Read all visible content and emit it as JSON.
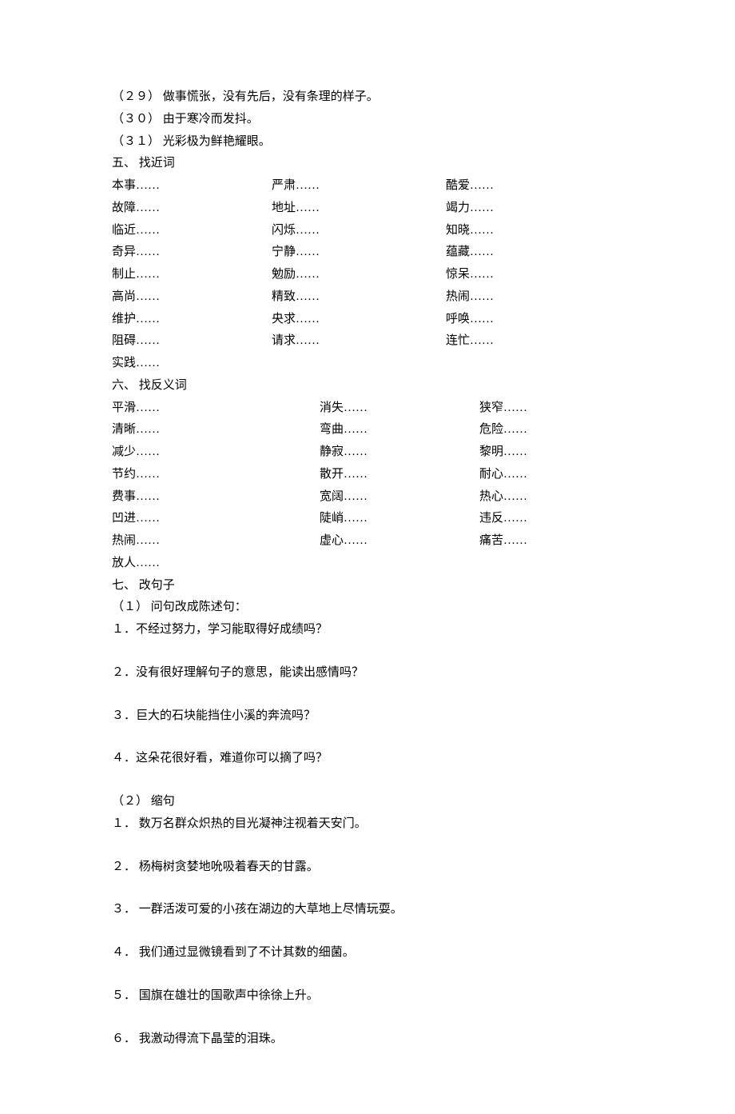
{
  "defs": [
    "（２９） 做事慌张，没有先后，没有条理的样子。",
    "（３０） 由于寒冷而发抖。",
    "（３１） 光彩极为鲜艳耀眼。"
  ],
  "sec5_title": "五、 找近词",
  "syn_rows": [
    [
      "本事……",
      "严肃……",
      "酷爱……"
    ],
    [
      "故障……",
      "地址……",
      "竭力……"
    ],
    [
      "临近……",
      "闪烁……",
      "知晓……"
    ],
    [
      "奇异……",
      "宁静……",
      "蕴藏……"
    ],
    [
      "制止……",
      "勉励……",
      "惊呆……"
    ],
    [
      "高尚……",
      "精致……",
      "热闹……"
    ],
    [
      "维护……",
      "央求……",
      "呼唤……"
    ],
    [
      "阻碍……",
      "请求……",
      "连忙……"
    ]
  ],
  "syn_last": "实践……",
  "sec6_title": "六、 找反义词",
  "ant_rows": [
    [
      "平滑……",
      "消失……",
      "狭窄……"
    ],
    [
      "清晰……",
      "弯曲……",
      "危险……"
    ],
    [
      "减少……",
      "静寂……",
      "黎明……"
    ],
    [
      "节约……",
      "散开……",
      "耐心……"
    ],
    [
      "费事……",
      "宽阔……",
      "热心……"
    ],
    [
      "凹进……",
      "陡峭……",
      "违反……"
    ],
    [
      "热闹……",
      "虚心……",
      "痛苦……"
    ]
  ],
  "ant_last": "放人……",
  "sec7_title": "七、 改句子",
  "part1_title": "（１） 问句改成陈述句：",
  "q1": [
    "１．不经过努力，学习能取得好成绩吗？",
    "２．没有很好理解句子的意思，能读出感情吗？",
    "３．巨大的石块能挡住小溪的奔流吗？",
    "４．这朵花很好看，难道你可以摘了吗？"
  ],
  "part2_title": "（２） 缩句",
  "q2": [
    "１． 数万名群众炽热的目光凝神注视着天安门。",
    "２． 杨梅树贪婪地吮吸着春天的甘露。",
    "３． 一群活泼可爱的小孩在湖边的大草地上尽情玩耍。",
    "４． 我们通过显微镜看到了不计其数的细菌。",
    "５． 国旗在雄壮的国歌声中徐徐上升。",
    "６． 我激动得流下晶莹的泪珠。"
  ]
}
